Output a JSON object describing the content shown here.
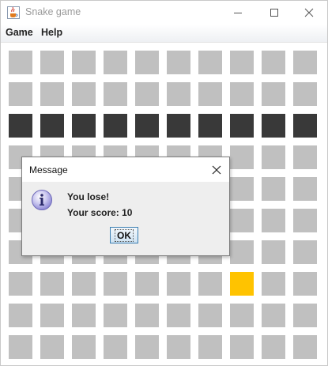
{
  "window": {
    "title": "Snake game",
    "app_icon": "java-coffee-cup-icon"
  },
  "menu": {
    "items": [
      "Game",
      "Help"
    ]
  },
  "board": {
    "cols": 10,
    "rows": 10,
    "snake": [
      [
        2,
        0
      ],
      [
        2,
        1
      ],
      [
        2,
        2
      ],
      [
        2,
        3
      ],
      [
        2,
        4
      ],
      [
        2,
        5
      ],
      [
        2,
        6
      ],
      [
        2,
        7
      ],
      [
        2,
        8
      ],
      [
        2,
        9
      ]
    ],
    "food": [
      7,
      7
    ],
    "colors": {
      "empty": "#c0c0c0",
      "snake": "#393939",
      "food": "#ffc300"
    }
  },
  "dialog": {
    "title": "Message",
    "icon": "info-icon",
    "line1": "You lose!",
    "line2": "Your score: 10",
    "ok_label": "OK"
  }
}
